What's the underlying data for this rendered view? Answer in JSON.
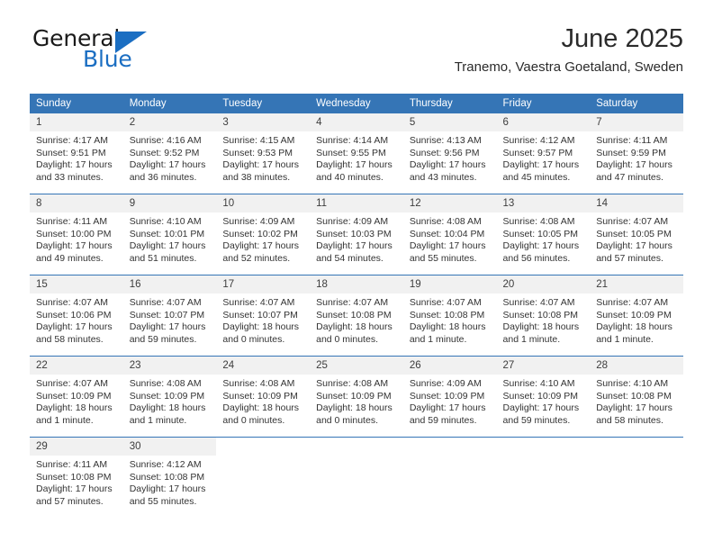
{
  "brand": {
    "word1": "General",
    "word2": "Blue",
    "accent_color": "#1b6ec2",
    "triangle_icon": "triangle-icon"
  },
  "header": {
    "month_title": "June 2025",
    "location": "Tranemo, Vaestra Goetaland, Sweden",
    "header_bg": "#3575b6",
    "daynum_bg": "#f1f1f1"
  },
  "weekday_headers": [
    "Sunday",
    "Monday",
    "Tuesday",
    "Wednesday",
    "Thursday",
    "Friday",
    "Saturday"
  ],
  "weeks": [
    [
      {
        "day": "1",
        "sunrise": "Sunrise: 4:17 AM",
        "sunset": "Sunset: 9:51 PM",
        "daylight1": "Daylight: 17 hours",
        "daylight2": "and 33 minutes."
      },
      {
        "day": "2",
        "sunrise": "Sunrise: 4:16 AM",
        "sunset": "Sunset: 9:52 PM",
        "daylight1": "Daylight: 17 hours",
        "daylight2": "and 36 minutes."
      },
      {
        "day": "3",
        "sunrise": "Sunrise: 4:15 AM",
        "sunset": "Sunset: 9:53 PM",
        "daylight1": "Daylight: 17 hours",
        "daylight2": "and 38 minutes."
      },
      {
        "day": "4",
        "sunrise": "Sunrise: 4:14 AM",
        "sunset": "Sunset: 9:55 PM",
        "daylight1": "Daylight: 17 hours",
        "daylight2": "and 40 minutes."
      },
      {
        "day": "5",
        "sunrise": "Sunrise: 4:13 AM",
        "sunset": "Sunset: 9:56 PM",
        "daylight1": "Daylight: 17 hours",
        "daylight2": "and 43 minutes."
      },
      {
        "day": "6",
        "sunrise": "Sunrise: 4:12 AM",
        "sunset": "Sunset: 9:57 PM",
        "daylight1": "Daylight: 17 hours",
        "daylight2": "and 45 minutes."
      },
      {
        "day": "7",
        "sunrise": "Sunrise: 4:11 AM",
        "sunset": "Sunset: 9:59 PM",
        "daylight1": "Daylight: 17 hours",
        "daylight2": "and 47 minutes."
      }
    ],
    [
      {
        "day": "8",
        "sunrise": "Sunrise: 4:11 AM",
        "sunset": "Sunset: 10:00 PM",
        "daylight1": "Daylight: 17 hours",
        "daylight2": "and 49 minutes."
      },
      {
        "day": "9",
        "sunrise": "Sunrise: 4:10 AM",
        "sunset": "Sunset: 10:01 PM",
        "daylight1": "Daylight: 17 hours",
        "daylight2": "and 51 minutes."
      },
      {
        "day": "10",
        "sunrise": "Sunrise: 4:09 AM",
        "sunset": "Sunset: 10:02 PM",
        "daylight1": "Daylight: 17 hours",
        "daylight2": "and 52 minutes."
      },
      {
        "day": "11",
        "sunrise": "Sunrise: 4:09 AM",
        "sunset": "Sunset: 10:03 PM",
        "daylight1": "Daylight: 17 hours",
        "daylight2": "and 54 minutes."
      },
      {
        "day": "12",
        "sunrise": "Sunrise: 4:08 AM",
        "sunset": "Sunset: 10:04 PM",
        "daylight1": "Daylight: 17 hours",
        "daylight2": "and 55 minutes."
      },
      {
        "day": "13",
        "sunrise": "Sunrise: 4:08 AM",
        "sunset": "Sunset: 10:05 PM",
        "daylight1": "Daylight: 17 hours",
        "daylight2": "and 56 minutes."
      },
      {
        "day": "14",
        "sunrise": "Sunrise: 4:07 AM",
        "sunset": "Sunset: 10:05 PM",
        "daylight1": "Daylight: 17 hours",
        "daylight2": "and 57 minutes."
      }
    ],
    [
      {
        "day": "15",
        "sunrise": "Sunrise: 4:07 AM",
        "sunset": "Sunset: 10:06 PM",
        "daylight1": "Daylight: 17 hours",
        "daylight2": "and 58 minutes."
      },
      {
        "day": "16",
        "sunrise": "Sunrise: 4:07 AM",
        "sunset": "Sunset: 10:07 PM",
        "daylight1": "Daylight: 17 hours",
        "daylight2": "and 59 minutes."
      },
      {
        "day": "17",
        "sunrise": "Sunrise: 4:07 AM",
        "sunset": "Sunset: 10:07 PM",
        "daylight1": "Daylight: 18 hours",
        "daylight2": "and 0 minutes."
      },
      {
        "day": "18",
        "sunrise": "Sunrise: 4:07 AM",
        "sunset": "Sunset: 10:08 PM",
        "daylight1": "Daylight: 18 hours",
        "daylight2": "and 0 minutes."
      },
      {
        "day": "19",
        "sunrise": "Sunrise: 4:07 AM",
        "sunset": "Sunset: 10:08 PM",
        "daylight1": "Daylight: 18 hours",
        "daylight2": "and 1 minute."
      },
      {
        "day": "20",
        "sunrise": "Sunrise: 4:07 AM",
        "sunset": "Sunset: 10:08 PM",
        "daylight1": "Daylight: 18 hours",
        "daylight2": "and 1 minute."
      },
      {
        "day": "21",
        "sunrise": "Sunrise: 4:07 AM",
        "sunset": "Sunset: 10:09 PM",
        "daylight1": "Daylight: 18 hours",
        "daylight2": "and 1 minute."
      }
    ],
    [
      {
        "day": "22",
        "sunrise": "Sunrise: 4:07 AM",
        "sunset": "Sunset: 10:09 PM",
        "daylight1": "Daylight: 18 hours",
        "daylight2": "and 1 minute."
      },
      {
        "day": "23",
        "sunrise": "Sunrise: 4:08 AM",
        "sunset": "Sunset: 10:09 PM",
        "daylight1": "Daylight: 18 hours",
        "daylight2": "and 1 minute."
      },
      {
        "day": "24",
        "sunrise": "Sunrise: 4:08 AM",
        "sunset": "Sunset: 10:09 PM",
        "daylight1": "Daylight: 18 hours",
        "daylight2": "and 0 minutes."
      },
      {
        "day": "25",
        "sunrise": "Sunrise: 4:08 AM",
        "sunset": "Sunset: 10:09 PM",
        "daylight1": "Daylight: 18 hours",
        "daylight2": "and 0 minutes."
      },
      {
        "day": "26",
        "sunrise": "Sunrise: 4:09 AM",
        "sunset": "Sunset: 10:09 PM",
        "daylight1": "Daylight: 17 hours",
        "daylight2": "and 59 minutes."
      },
      {
        "day": "27",
        "sunrise": "Sunrise: 4:10 AM",
        "sunset": "Sunset: 10:09 PM",
        "daylight1": "Daylight: 17 hours",
        "daylight2": "and 59 minutes."
      },
      {
        "day": "28",
        "sunrise": "Sunrise: 4:10 AM",
        "sunset": "Sunset: 10:08 PM",
        "daylight1": "Daylight: 17 hours",
        "daylight2": "and 58 minutes."
      }
    ],
    [
      {
        "day": "29",
        "sunrise": "Sunrise: 4:11 AM",
        "sunset": "Sunset: 10:08 PM",
        "daylight1": "Daylight: 17 hours",
        "daylight2": "and 57 minutes."
      },
      {
        "day": "30",
        "sunrise": "Sunrise: 4:12 AM",
        "sunset": "Sunset: 10:08 PM",
        "daylight1": "Daylight: 17 hours",
        "daylight2": "and 55 minutes."
      },
      {
        "day": "",
        "sunrise": "",
        "sunset": "",
        "daylight1": "",
        "daylight2": ""
      },
      {
        "day": "",
        "sunrise": "",
        "sunset": "",
        "daylight1": "",
        "daylight2": ""
      },
      {
        "day": "",
        "sunrise": "",
        "sunset": "",
        "daylight1": "",
        "daylight2": ""
      },
      {
        "day": "",
        "sunrise": "",
        "sunset": "",
        "daylight1": "",
        "daylight2": ""
      },
      {
        "day": "",
        "sunrise": "",
        "sunset": "",
        "daylight1": "",
        "daylight2": ""
      }
    ]
  ]
}
